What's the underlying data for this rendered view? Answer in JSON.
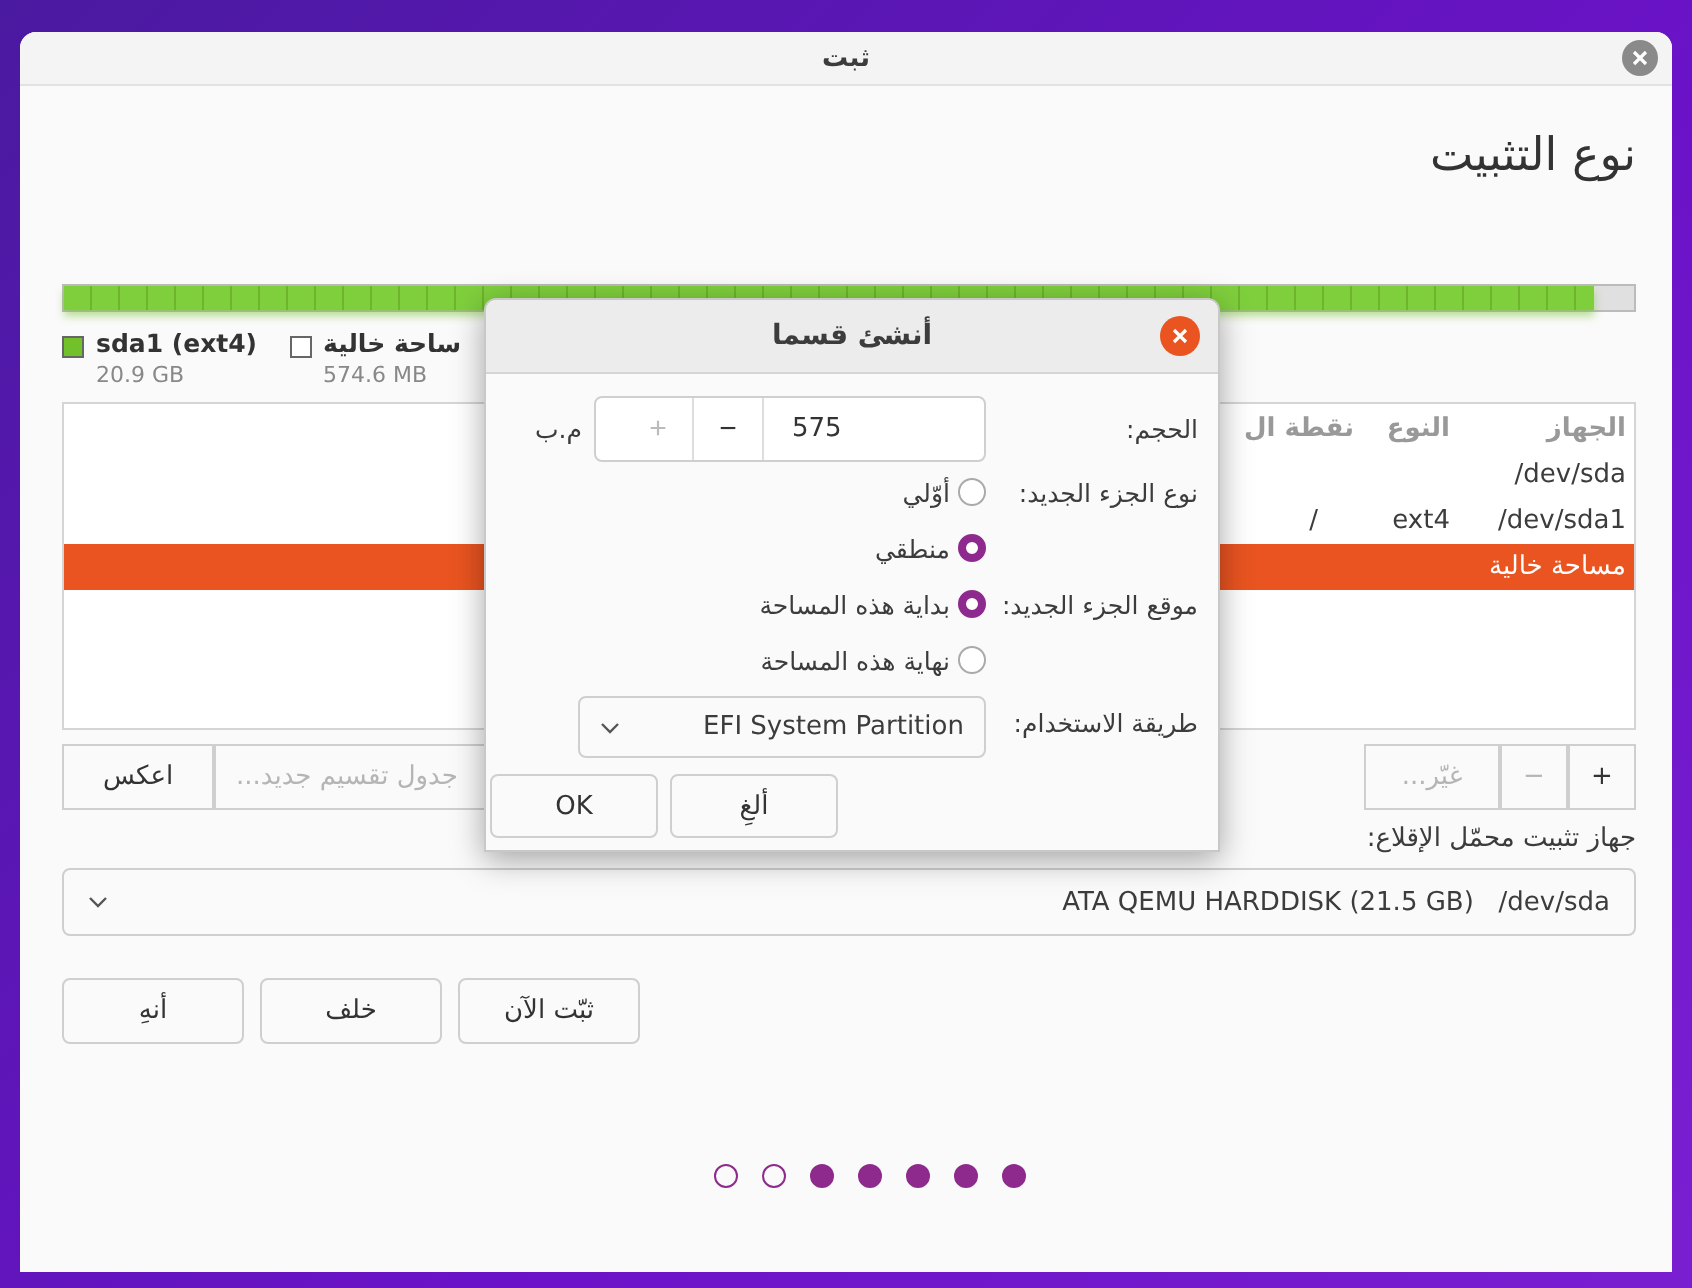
{
  "window": {
    "title": "ثبت",
    "heading": "نوع التثبيت"
  },
  "partition_bar": {
    "level": 0.974
  },
  "legend": [
    {
      "label": "ساحة خالية",
      "size": "574.6 MB",
      "color": "#ffffff"
    },
    {
      "label": "sda1 (ext4)",
      "size": "20.9 GB",
      "color": "#73c12a"
    }
  ],
  "table": {
    "columns": [
      "الجهاز",
      "النوع",
      "نقطة ال"
    ],
    "rows": [
      {
        "cells": [
          "/dev/sda",
          "",
          ""
        ],
        "selected": false
      },
      {
        "cells": [
          "/dev/sda1",
          "ext4",
          "/"
        ],
        "selected": false
      },
      {
        "cells": [
          "مساحة خالية",
          "",
          ""
        ],
        "selected": true
      }
    ]
  },
  "toolbar": {
    "add": "+",
    "remove": "−",
    "change": "غيّر...",
    "change_disabled": true,
    "new_table": "جدول تقسيم جديد...",
    "revert": "اعكس"
  },
  "bootloader": {
    "label": "جهاز تثبيت محمّل الإقلاع:",
    "value": "ATA QEMU HARDDISK (21.5 GB)   /dev/sda"
  },
  "buttons": [
    {
      "label": "ثبّت الآن"
    },
    {
      "label": "خلف"
    },
    {
      "label": "أنهِ"
    }
  ],
  "steps": [
    {
      "filled": false
    },
    {
      "filled": false
    },
    {
      "filled": true
    },
    {
      "filled": true
    },
    {
      "filled": true
    },
    {
      "filled": true
    },
    {
      "filled": true
    }
  ],
  "dialog": {
    "title": "أنشئ قسما",
    "size_label": "الحجم:",
    "size_value": "575",
    "size_unit": "م.ب",
    "plus": "+",
    "minus": "−",
    "plus_disabled": true,
    "type_label": "نوع الجزء الجديد:",
    "type_options": [
      {
        "label": "أوّلي",
        "selected": false
      },
      {
        "label": "منطقي",
        "selected": true
      }
    ],
    "location_label": "موقع الجزء الجديد:",
    "location_options": [
      {
        "label": "بداية هذه المساحة",
        "selected": true
      },
      {
        "label": "نهاية هذه المساحة",
        "selected": false
      }
    ],
    "use_label": "طريقة الاستخدام:",
    "use_value": "EFI System Partition",
    "ok": "OK",
    "cancel": "ألغِ"
  }
}
